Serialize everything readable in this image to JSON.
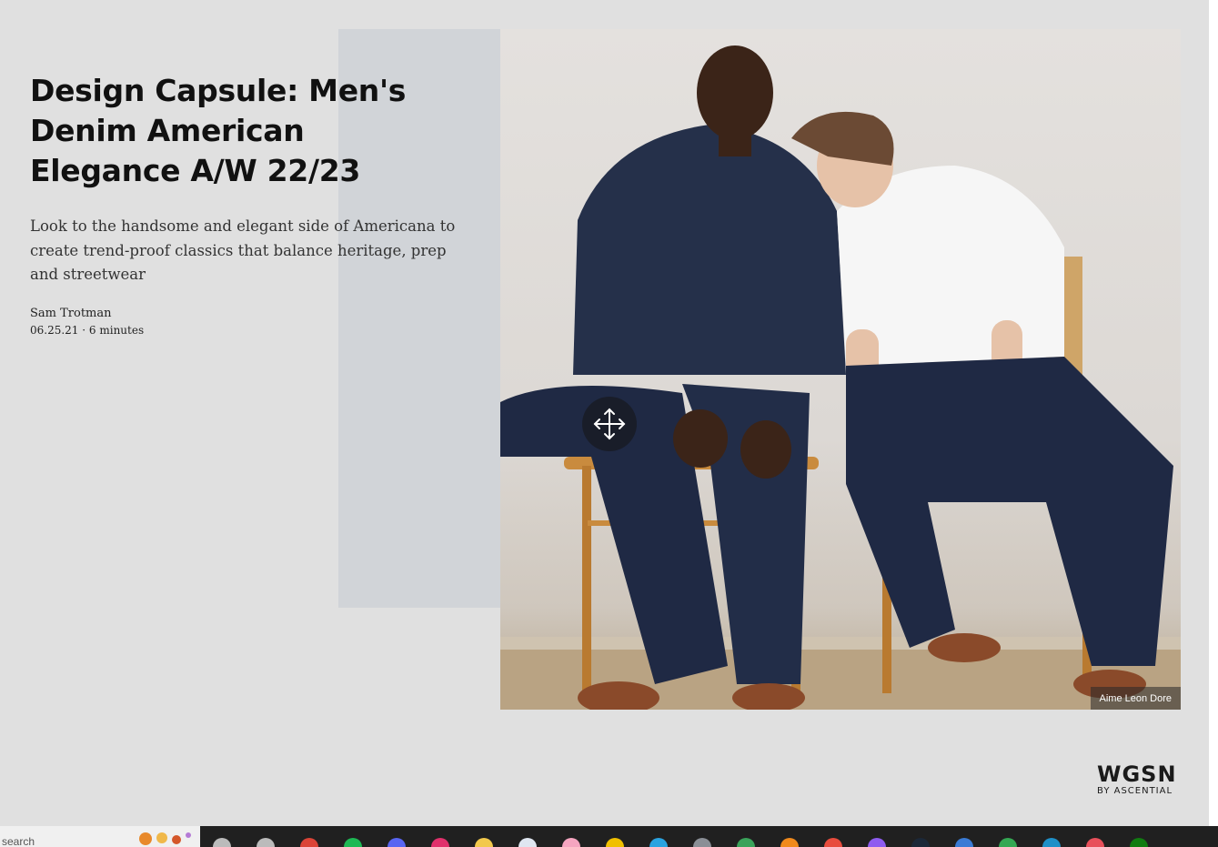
{
  "article": {
    "title": "Design Capsule: Men's Denim American Elegance A/W 22/23",
    "subtitle": "Look to the handsome and elegant side of Americana to create trend-proof classics that balance heritage, prep and streetwear",
    "author": "Sam Trotman",
    "date": "06.25.21",
    "reading_time": "6 minutes"
  },
  "hero": {
    "caption": "Aime Leon Dore",
    "move_icon": "move-arrows-icon"
  },
  "logo": {
    "main": "WGSN",
    "sub": "BY ASCENTIAL"
  },
  "taskbar": {
    "search_placeholder": "search",
    "apps": [
      {
        "icon": "search-icon",
        "color": "#bbbbbb"
      },
      {
        "icon": "task-view-icon",
        "color": "#bbbbbb"
      },
      {
        "icon": "chrome-icon",
        "color": "#db4437"
      },
      {
        "icon": "spotify-icon",
        "color": "#1db954"
      },
      {
        "icon": "discord-icon",
        "color": "#5865f2"
      },
      {
        "icon": "instagram-icon",
        "color": "#e1306c"
      },
      {
        "icon": "file-explorer-icon",
        "color": "#f2c94c"
      },
      {
        "icon": "mail-icon",
        "color": "#dfe6f0"
      },
      {
        "icon": "app-icon",
        "color": "#f5a5c0"
      },
      {
        "icon": "app-icon",
        "color": "#f0c000"
      },
      {
        "icon": "telegram-icon",
        "color": "#2aa3e0"
      },
      {
        "icon": "calculator-icon",
        "color": "#8a8f96"
      },
      {
        "icon": "app-icon",
        "color": "#3aa35a"
      },
      {
        "icon": "blender-icon",
        "color": "#f08a1c"
      },
      {
        "icon": "app-icon",
        "color": "#e84c3d"
      },
      {
        "icon": "app-icon",
        "color": "#8e5cf0"
      },
      {
        "icon": "steam-icon",
        "color": "#1b2838"
      },
      {
        "icon": "app-icon",
        "color": "#3a7bd5"
      },
      {
        "icon": "play-store-icon",
        "color": "#34a853"
      },
      {
        "icon": "app-icon",
        "color": "#1e90c8"
      },
      {
        "icon": "app-icon",
        "color": "#e8505b"
      },
      {
        "icon": "xbox-icon",
        "color": "#107c10"
      }
    ]
  }
}
